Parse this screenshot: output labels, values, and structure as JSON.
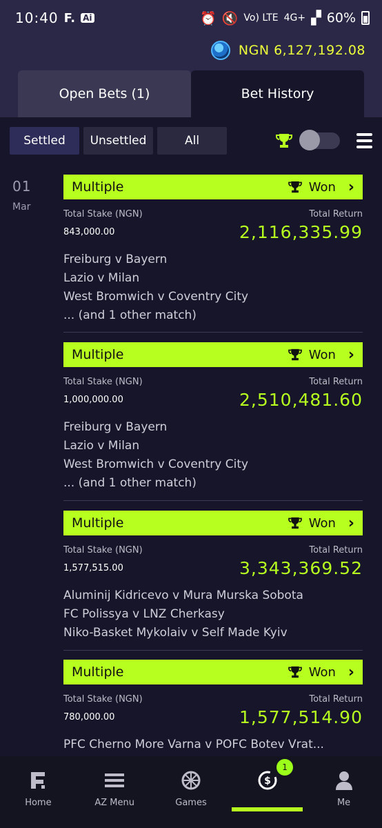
{
  "status_bar": {
    "time": "10:40",
    "app_f": "F.",
    "app_ai": "Ai",
    "network": "Vo) LTE",
    "signal": "4G+",
    "battery": "60%"
  },
  "header": {
    "balance": "NGN 6,127,192.08",
    "tabs": [
      {
        "label": "Open Bets (1)",
        "active": false
      },
      {
        "label": "Bet History",
        "active": true
      }
    ]
  },
  "filters": {
    "buttons": [
      {
        "label": "Settled",
        "active": true
      },
      {
        "label": "Unsettled",
        "active": false
      },
      {
        "label": "All",
        "active": false
      }
    ]
  },
  "date": {
    "day": "01",
    "month": "Mar"
  },
  "labels": {
    "total_stake": "Total Stake (NGN)",
    "total_return": "Total Return"
  },
  "bets": [
    {
      "type": "Multiple",
      "status": "Won",
      "stake": "843,000.00",
      "return": "2,116,335.99",
      "matches": [
        "Freiburg v Bayern",
        "Lazio v Milan",
        "West Bromwich v Coventry City",
        "... (and 1 other match)"
      ]
    },
    {
      "type": "Multiple",
      "status": "Won",
      "stake": "1,000,000.00",
      "return": "2,510,481.60",
      "matches": [
        "Freiburg v Bayern",
        "Lazio v Milan",
        "West Bromwich v Coventry City",
        "... (and 1 other match)"
      ]
    },
    {
      "type": "Multiple",
      "status": "Won",
      "stake": "1,577,515.00",
      "return": "3,343,369.52",
      "matches": [
        "Aluminij Kidricevo v Mura Murska Sobota",
        "FC Polissya v LNZ Cherkasy",
        "Niko-Basket Mykolaiv v Self Made Kyiv"
      ]
    },
    {
      "type": "Multiple",
      "status": "Won",
      "stake": "780,000.00",
      "return": "1,577,514.90",
      "matches": [
        "PFC Cherno More Varna v POFC Botev Vrat..."
      ]
    }
  ],
  "bottom_nav": {
    "items": [
      {
        "label": "Home",
        "icon": "home-f-icon"
      },
      {
        "label": "AZ Menu",
        "icon": "menu-icon"
      },
      {
        "label": "Games",
        "icon": "games-wheel-icon"
      },
      {
        "label": "",
        "icon": "mybets-icon",
        "badge": "1",
        "active": true
      },
      {
        "label": "Me",
        "icon": "user-icon"
      }
    ]
  },
  "colors": {
    "accent": "#b6ff1f",
    "balance": "#ecff3a",
    "header_bg": "#2b2847",
    "body_bg": "#16152a"
  }
}
